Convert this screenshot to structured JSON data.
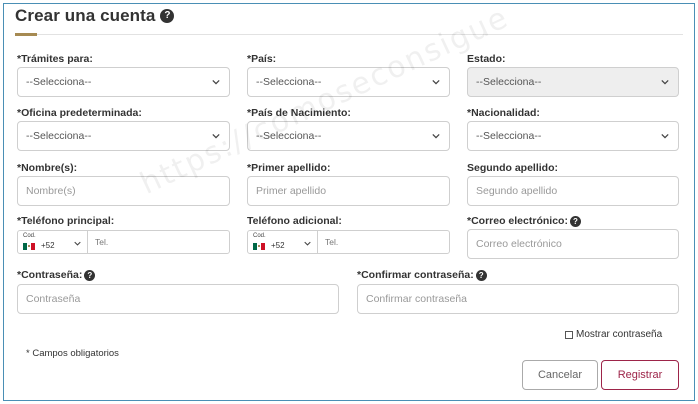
{
  "header": {
    "title": "Crear una cuenta",
    "help_icon": "question-circle-icon"
  },
  "fields": {
    "tramites": {
      "label": "*Trámites para:",
      "value": "--Selecciona--"
    },
    "pais": {
      "label": "*País:",
      "value": "--Selecciona--"
    },
    "estado": {
      "label": "Estado:",
      "value": "--Selecciona--"
    },
    "oficina": {
      "label": "*Oficina predeterminada:",
      "value": "--Selecciona--"
    },
    "pais_nacimiento": {
      "label": "*País de Nacimiento:",
      "value": "--Selecciona--"
    },
    "nacionalidad": {
      "label": "*Nacionalidad:",
      "value": "--Selecciona--"
    },
    "nombre": {
      "label": "*Nombre(s):",
      "placeholder": "Nombre(s)"
    },
    "primer_apellido": {
      "label": "*Primer apellido:",
      "placeholder": "Primer apellido"
    },
    "segundo_apellido": {
      "label": "Segundo apellido:",
      "placeholder": "Segundo apellido"
    },
    "telefono_principal": {
      "label": "*Teléfono principal:",
      "cod": "Cod.",
      "code": "+52",
      "placeholder": "Tel."
    },
    "telefono_adicional": {
      "label": "Teléfono adicional:",
      "cod": "Cod.",
      "code": "+52",
      "placeholder": "Tel."
    },
    "correo": {
      "label": "*Correo electrónico:",
      "placeholder": "Correo electrónico"
    },
    "contrasena": {
      "label": "*Contraseña:",
      "placeholder": "Contraseña"
    },
    "confirmar": {
      "label": "*Confirmar contraseña:",
      "placeholder": "Confirmar contraseña"
    }
  },
  "show_password": {
    "label": "Mostrar contraseña",
    "checked": false
  },
  "required_note": "* Campos obligatorios",
  "buttons": {
    "cancel": "Cancelar",
    "register": "Registrar"
  },
  "watermark": "https://comoseconsigue",
  "colors": {
    "accent": "#9d2449",
    "gold": "#a68a52",
    "frame": "#4a8fb5"
  }
}
